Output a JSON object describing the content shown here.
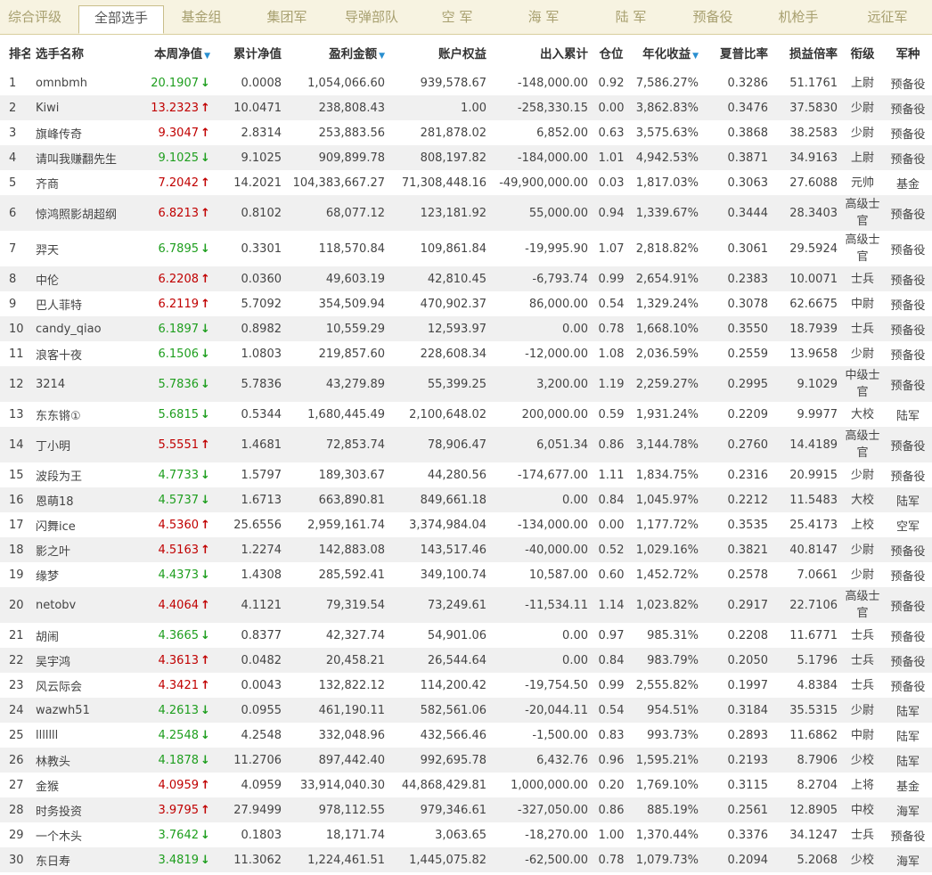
{
  "tabs": [
    "综合评级",
    "全部选手",
    "基金组",
    "集团军",
    "导弹部队",
    "空 军",
    "海 军",
    "陆 军",
    "预备役",
    "机枪手",
    "远征军"
  ],
  "active_tab": 1,
  "columns": [
    "排名",
    "选手名称",
    "本周净值",
    "累计净值",
    "盈利金额",
    "账户权益",
    "出入累计",
    "仓位",
    "年化收益",
    "夏普比率",
    "损益倍率",
    "衔级",
    "军种"
  ],
  "sortable_columns": [
    2,
    4,
    8
  ],
  "colors": {
    "up": "#c00000",
    "down": "#1e9e1e",
    "sort_arrow": "#2a8fd0",
    "active_tab_border": "#c9be8a"
  },
  "rows": [
    {
      "rank": "1",
      "name": "omnbmh",
      "week": "20.1907",
      "dir": "down",
      "cum": "0.0008",
      "profit": "1,054,066.60",
      "equity": "939,578.67",
      "flow": "-148,000.00",
      "pos": "0.92",
      "annual": "7,586.27%",
      "sharpe": "0.3286",
      "ratio": "51.1761",
      "rank_title": "上尉",
      "branch": "预备役"
    },
    {
      "rank": "2",
      "name": "Kiwi",
      "week": "13.2323",
      "dir": "up",
      "cum": "10.0471",
      "profit": "238,808.43",
      "equity": "1.00",
      "flow": "-258,330.15",
      "pos": "0.00",
      "annual": "3,862.83%",
      "sharpe": "0.3476",
      "ratio": "37.5830",
      "rank_title": "少尉",
      "branch": "预备役"
    },
    {
      "rank": "3",
      "name": "旗峰传奇",
      "week": "9.3047",
      "dir": "up",
      "cum": "2.8314",
      "profit": "253,883.56",
      "equity": "281,878.02",
      "flow": "6,852.00",
      "pos": "0.63",
      "annual": "3,575.63%",
      "sharpe": "0.3868",
      "ratio": "38.2583",
      "rank_title": "少尉",
      "branch": "预备役"
    },
    {
      "rank": "4",
      "name": "请叫我赚翻先生",
      "week": "9.1025",
      "dir": "down",
      "cum": "9.1025",
      "profit": "909,899.78",
      "equity": "808,197.82",
      "flow": "-184,000.00",
      "pos": "1.01",
      "annual": "4,942.53%",
      "sharpe": "0.3871",
      "ratio": "34.9163",
      "rank_title": "上尉",
      "branch": "预备役"
    },
    {
      "rank": "5",
      "name": "齐商",
      "week": "7.2042",
      "dir": "up",
      "cum": "14.2021",
      "profit": "104,383,667.27",
      "equity": "71,308,448.16",
      "flow": "-49,900,000.00",
      "pos": "0.03",
      "annual": "1,817.03%",
      "sharpe": "0.3063",
      "ratio": "27.6088",
      "rank_title": "元帅",
      "branch": "基金"
    },
    {
      "rank": "6",
      "name": "惊鸿照影胡超纲",
      "week": "6.8213",
      "dir": "up",
      "cum": "0.8102",
      "profit": "68,077.12",
      "equity": "123,181.92",
      "flow": "55,000.00",
      "pos": "0.94",
      "annual": "1,339.67%",
      "sharpe": "0.3444",
      "ratio": "28.3403",
      "rank_title": "高级士官",
      "branch": "预备役"
    },
    {
      "rank": "7",
      "name": "羿天",
      "week": "6.7895",
      "dir": "down",
      "cum": "0.3301",
      "profit": "118,570.84",
      "equity": "109,861.84",
      "flow": "-19,995.90",
      "pos": "1.07",
      "annual": "2,818.82%",
      "sharpe": "0.3061",
      "ratio": "29.5924",
      "rank_title": "高级士官",
      "branch": "预备役"
    },
    {
      "rank": "8",
      "name": "中伦",
      "week": "6.2208",
      "dir": "up",
      "cum": "0.0360",
      "profit": "49,603.19",
      "equity": "42,810.45",
      "flow": "-6,793.74",
      "pos": "0.99",
      "annual": "2,654.91%",
      "sharpe": "0.2383",
      "ratio": "10.0071",
      "rank_title": "士兵",
      "branch": "预备役"
    },
    {
      "rank": "9",
      "name": "巴人菲特",
      "week": "6.2119",
      "dir": "up",
      "cum": "5.7092",
      "profit": "354,509.94",
      "equity": "470,902.37",
      "flow": "86,000.00",
      "pos": "0.54",
      "annual": "1,329.24%",
      "sharpe": "0.3078",
      "ratio": "62.6675",
      "rank_title": "中尉",
      "branch": "预备役"
    },
    {
      "rank": "10",
      "name": "candy_qiao",
      "week": "6.1897",
      "dir": "down",
      "cum": "0.8982",
      "profit": "10,559.29",
      "equity": "12,593.97",
      "flow": "0.00",
      "pos": "0.78",
      "annual": "1,668.10%",
      "sharpe": "0.3550",
      "ratio": "18.7939",
      "rank_title": "士兵",
      "branch": "预备役"
    },
    {
      "rank": "11",
      "name": "浪客十夜",
      "week": "6.1506",
      "dir": "down",
      "cum": "1.0803",
      "profit": "219,857.60",
      "equity": "228,608.34",
      "flow": "-12,000.00",
      "pos": "1.08",
      "annual": "2,036.59%",
      "sharpe": "0.2559",
      "ratio": "13.9658",
      "rank_title": "少尉",
      "branch": "预备役"
    },
    {
      "rank": "12",
      "name": "3214",
      "week": "5.7836",
      "dir": "down",
      "cum": "5.7836",
      "profit": "43,279.89",
      "equity": "55,399.25",
      "flow": "3,200.00",
      "pos": "1.19",
      "annual": "2,259.27%",
      "sharpe": "0.2995",
      "ratio": "9.1029",
      "rank_title": "中级士官",
      "branch": "预备役"
    },
    {
      "rank": "13",
      "name": "东东锵①",
      "week": "5.6815",
      "dir": "down",
      "cum": "0.5344",
      "profit": "1,680,445.49",
      "equity": "2,100,648.02",
      "flow": "200,000.00",
      "pos": "0.59",
      "annual": "1,931.24%",
      "sharpe": "0.2209",
      "ratio": "9.9977",
      "rank_title": "大校",
      "branch": "陆军"
    },
    {
      "rank": "14",
      "name": "丁小明",
      "week": "5.5551",
      "dir": "up",
      "cum": "1.4681",
      "profit": "72,853.74",
      "equity": "78,906.47",
      "flow": "6,051.34",
      "pos": "0.86",
      "annual": "3,144.78%",
      "sharpe": "0.2760",
      "ratio": "14.4189",
      "rank_title": "高级士官",
      "branch": "预备役"
    },
    {
      "rank": "15",
      "name": "波段为王",
      "week": "4.7733",
      "dir": "down",
      "cum": "1.5797",
      "profit": "189,303.67",
      "equity": "44,280.56",
      "flow": "-174,677.00",
      "pos": "1.11",
      "annual": "1,834.75%",
      "sharpe": "0.2316",
      "ratio": "20.9915",
      "rank_title": "少尉",
      "branch": "预备役"
    },
    {
      "rank": "16",
      "name": "恩萌18",
      "week": "4.5737",
      "dir": "down",
      "cum": "1.6713",
      "profit": "663,890.81",
      "equity": "849,661.18",
      "flow": "0.00",
      "pos": "0.84",
      "annual": "1,045.97%",
      "sharpe": "0.2212",
      "ratio": "11.5483",
      "rank_title": "大校",
      "branch": "陆军"
    },
    {
      "rank": "17",
      "name": "闪舞ice",
      "week": "4.5360",
      "dir": "up",
      "cum": "25.6556",
      "profit": "2,959,161.74",
      "equity": "3,374,984.04",
      "flow": "-134,000.00",
      "pos": "0.00",
      "annual": "1,177.72%",
      "sharpe": "0.3535",
      "ratio": "25.4173",
      "rank_title": "上校",
      "branch": "空军"
    },
    {
      "rank": "18",
      "name": "影之叶",
      "week": "4.5163",
      "dir": "up",
      "cum": "1.2274",
      "profit": "142,883.08",
      "equity": "143,517.46",
      "flow": "-40,000.00",
      "pos": "0.52",
      "annual": "1,029.16%",
      "sharpe": "0.3821",
      "ratio": "40.8147",
      "rank_title": "少尉",
      "branch": "预备役"
    },
    {
      "rank": "19",
      "name": "缘梦",
      "week": "4.4373",
      "dir": "down",
      "cum": "1.4308",
      "profit": "285,592.41",
      "equity": "349,100.74",
      "flow": "10,587.00",
      "pos": "0.60",
      "annual": "1,452.72%",
      "sharpe": "0.2578",
      "ratio": "7.0661",
      "rank_title": "少尉",
      "branch": "预备役"
    },
    {
      "rank": "20",
      "name": "netobv",
      "week": "4.4064",
      "dir": "up",
      "cum": "4.1121",
      "profit": "79,319.54",
      "equity": "73,249.61",
      "flow": "-11,534.11",
      "pos": "1.14",
      "annual": "1,023.82%",
      "sharpe": "0.2917",
      "ratio": "22.7106",
      "rank_title": "高级士官",
      "branch": "预备役"
    },
    {
      "rank": "21",
      "name": "胡闹",
      "week": "4.3665",
      "dir": "down",
      "cum": "0.8377",
      "profit": "42,327.74",
      "equity": "54,901.06",
      "flow": "0.00",
      "pos": "0.97",
      "annual": "985.31%",
      "sharpe": "0.2208",
      "ratio": "11.6771",
      "rank_title": "士兵",
      "branch": "预备役"
    },
    {
      "rank": "22",
      "name": "吴宇鸿",
      "week": "4.3613",
      "dir": "up",
      "cum": "0.0482",
      "profit": "20,458.21",
      "equity": "26,544.64",
      "flow": "0.00",
      "pos": "0.84",
      "annual": "983.79%",
      "sharpe": "0.2050",
      "ratio": "5.1796",
      "rank_title": "士兵",
      "branch": "预备役"
    },
    {
      "rank": "23",
      "name": "风云际会",
      "week": "4.3421",
      "dir": "up",
      "cum": "0.0043",
      "profit": "132,822.12",
      "equity": "114,200.42",
      "flow": "-19,754.50",
      "pos": "0.99",
      "annual": "2,555.82%",
      "sharpe": "0.1997",
      "ratio": "4.8384",
      "rank_title": "士兵",
      "branch": "预备役"
    },
    {
      "rank": "24",
      "name": "wazwh51",
      "week": "4.2613",
      "dir": "down",
      "cum": "0.0955",
      "profit": "461,190.11",
      "equity": "582,561.06",
      "flow": "-20,044.11",
      "pos": "0.54",
      "annual": "954.51%",
      "sharpe": "0.3184",
      "ratio": "35.5315",
      "rank_title": "少尉",
      "branch": "陆军"
    },
    {
      "rank": "25",
      "name": "lllllll",
      "week": "4.2548",
      "dir": "down",
      "cum": "4.2548",
      "profit": "332,048.96",
      "equity": "432,566.46",
      "flow": "-1,500.00",
      "pos": "0.83",
      "annual": "993.73%",
      "sharpe": "0.2893",
      "ratio": "11.6862",
      "rank_title": "中尉",
      "branch": "陆军"
    },
    {
      "rank": "26",
      "name": "林教头",
      "week": "4.1878",
      "dir": "down",
      "cum": "11.2706",
      "profit": "897,442.40",
      "equity": "992,695.78",
      "flow": "6,432.76",
      "pos": "0.96",
      "annual": "1,595.21%",
      "sharpe": "0.2193",
      "ratio": "8.7906",
      "rank_title": "少校",
      "branch": "陆军"
    },
    {
      "rank": "27",
      "name": "金猴",
      "week": "4.0959",
      "dir": "up",
      "cum": "4.0959",
      "profit": "33,914,040.30",
      "equity": "44,868,429.81",
      "flow": "1,000,000.00",
      "pos": "0.20",
      "annual": "1,769.10%",
      "sharpe": "0.3115",
      "ratio": "8.2704",
      "rank_title": "上将",
      "branch": "基金"
    },
    {
      "rank": "28",
      "name": "时务投资",
      "week": "3.9795",
      "dir": "up",
      "cum": "27.9499",
      "profit": "978,112.55",
      "equity": "979,346.61",
      "flow": "-327,050.00",
      "pos": "0.86",
      "annual": "885.19%",
      "sharpe": "0.2561",
      "ratio": "12.8905",
      "rank_title": "中校",
      "branch": "海军"
    },
    {
      "rank": "29",
      "name": "一个木头",
      "week": "3.7642",
      "dir": "down",
      "cum": "0.1803",
      "profit": "18,171.74",
      "equity": "3,063.65",
      "flow": "-18,270.00",
      "pos": "1.00",
      "annual": "1,370.44%",
      "sharpe": "0.3376",
      "ratio": "34.1247",
      "rank_title": "士兵",
      "branch": "预备役"
    },
    {
      "rank": "30",
      "name": "东日寿",
      "week": "3.4819",
      "dir": "down",
      "cum": "11.3062",
      "profit": "1,224,461.51",
      "equity": "1,445,075.82",
      "flow": "-62,500.00",
      "pos": "0.78",
      "annual": "1,079.73%",
      "sharpe": "0.2094",
      "ratio": "5.2068",
      "rank_title": "少校",
      "branch": "海军"
    }
  ]
}
